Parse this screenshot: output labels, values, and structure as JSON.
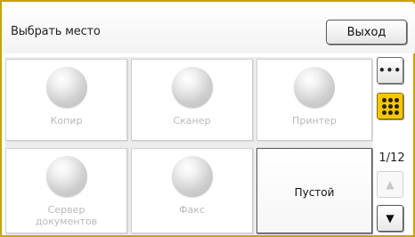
{
  "header": {
    "title": "Выбрать место",
    "exit_label": "Выход"
  },
  "tiles": [
    {
      "label": "Копир",
      "enabled": false
    },
    {
      "label": "Сканер",
      "enabled": false
    },
    {
      "label": "Принтер",
      "enabled": false
    },
    {
      "label_line1": "Сервер",
      "label_line2": "документов",
      "enabled": false
    },
    {
      "label": "Факс",
      "enabled": false
    },
    {
      "label": "Пустой",
      "enabled": true
    }
  ],
  "side": {
    "page_indicator": "1/12",
    "up_arrow": "▲",
    "down_arrow": "▼",
    "view_three_dots_icon": "three-dots-icon",
    "view_grid_icon": "nine-dots-icon",
    "active_view": "grid"
  },
  "colors": {
    "accent": "#f5c800",
    "frame": "#c9a200"
  }
}
